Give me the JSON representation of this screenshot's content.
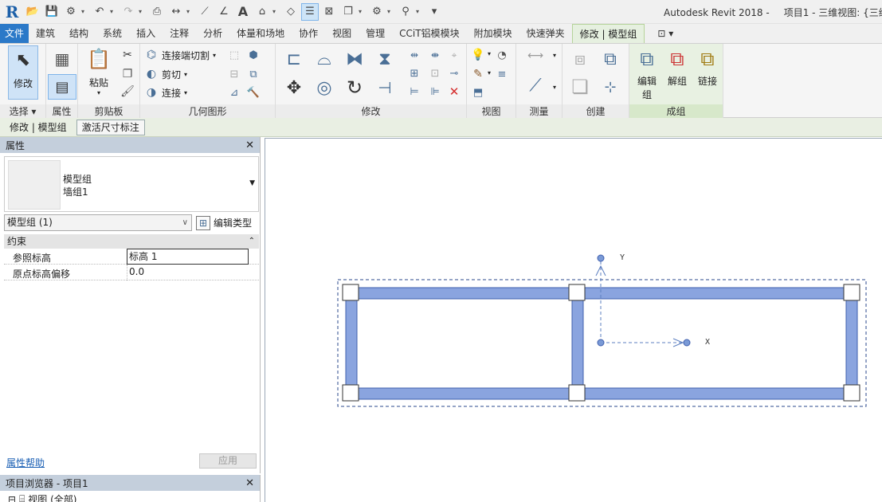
{
  "window": {
    "app_title": "Autodesk Revit 2018 -",
    "doc_title": "项目1 - 三维视图: {三维"
  },
  "ribbon_tabs": [
    {
      "label": "文件"
    },
    {
      "label": "建筑"
    },
    {
      "label": "结构"
    },
    {
      "label": "系统"
    },
    {
      "label": "插入"
    },
    {
      "label": "注释"
    },
    {
      "label": "分析"
    },
    {
      "label": "体量和场地"
    },
    {
      "label": "协作"
    },
    {
      "label": "视图"
    },
    {
      "label": "管理"
    },
    {
      "label": "CCiT铝模模块"
    },
    {
      "label": "附加模块"
    },
    {
      "label": "快速弹夹"
    },
    {
      "label": "修改 | 模型组"
    }
  ],
  "ribbon": {
    "select_panel": {
      "button": "修改",
      "label": "选择 ▾"
    },
    "properties_panel": {
      "label": "属性"
    },
    "clipboard_panel": {
      "paste": "粘贴",
      "label": "剪贴板"
    },
    "geometry_panel": {
      "join_cut": "连接端切割",
      "cut": "剪切",
      "join": "连接",
      "label": "几何图形"
    },
    "modify_panel": {
      "label": "修改"
    },
    "view_panel": {
      "label": "视图"
    },
    "measure_panel": {
      "label": "测量"
    },
    "create_panel": {
      "label": "创建"
    },
    "group_panel": {
      "edit": "编辑",
      "edit2": "组",
      "ungroup": "解组",
      "link": "链接",
      "label": "成组"
    }
  },
  "options_bar": {
    "context": "修改 | 模型组",
    "activate_dims": "激活尺寸标注"
  },
  "properties": {
    "title": "属性",
    "type_name_line1": "模型组",
    "type_name_line2": "墙组1",
    "filter": "模型组 (1)",
    "edit_type": "编辑类型",
    "category": "约束",
    "rows": [
      {
        "key": "参照标高",
        "value": "标高 1"
      },
      {
        "key": "原点标高偏移",
        "value": "0.0"
      }
    ],
    "help": "属性帮助",
    "apply": "应用"
  },
  "browser": {
    "title": "项目浏览器 - 项目1",
    "tree_item": "视图 (全部)"
  },
  "canvas": {
    "axis_y": "Y",
    "axis_x": "X",
    "wall_color": "#8aa4df",
    "wall_edge_color": "#3f5fae"
  }
}
